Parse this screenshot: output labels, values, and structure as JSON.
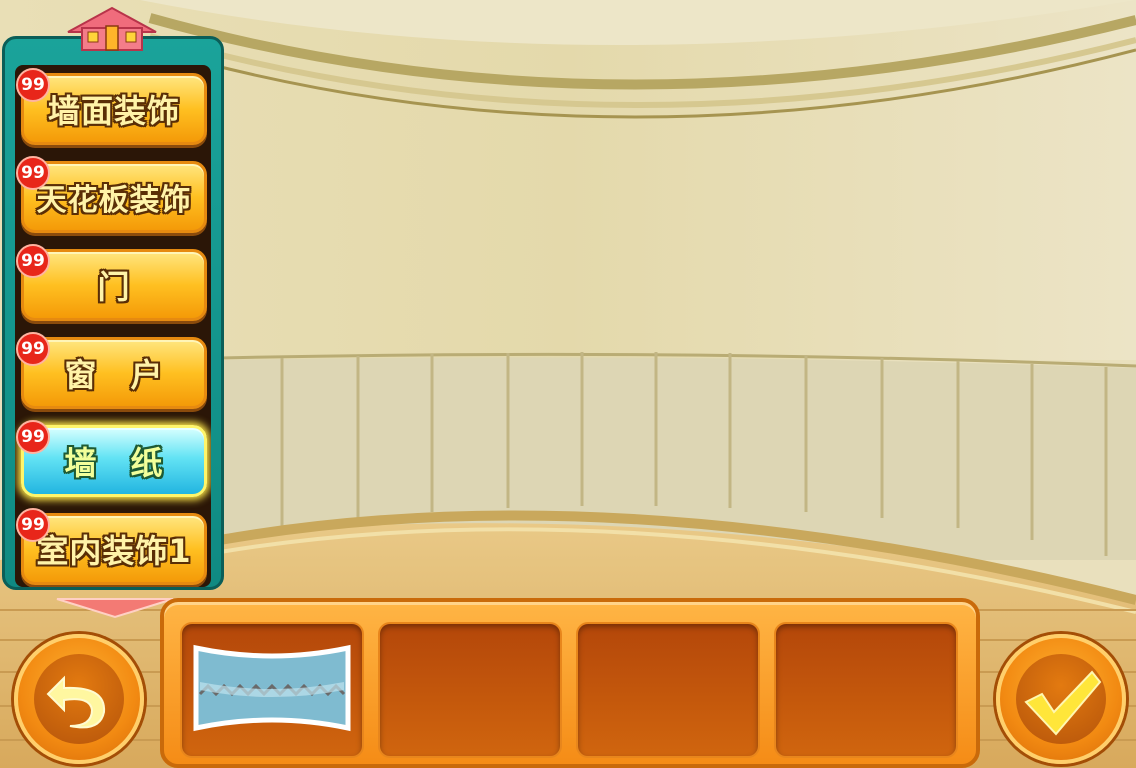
{
  "categories": [
    {
      "label": "墙面装饰",
      "badge": "99",
      "active": false
    },
    {
      "label": "天花板装饰",
      "badge": "99",
      "active": false
    },
    {
      "label": "门",
      "badge": "99",
      "active": false
    },
    {
      "label": "窗　户",
      "badge": "99",
      "active": false
    },
    {
      "label": "墙　纸",
      "badge": "99",
      "active": true
    },
    {
      "label": "室内装饰1",
      "badge": "99",
      "active": false
    }
  ],
  "panel_icons": {
    "top": "house-icon",
    "bottom": "scroll-down-arrow-icon"
  },
  "item_tray": {
    "slots": [
      {
        "item": "wallpaper-swatch-icon",
        "filled": true
      },
      {
        "item": "",
        "filled": false
      },
      {
        "item": "",
        "filled": false
      },
      {
        "item": "",
        "filled": false
      }
    ]
  },
  "buttons": {
    "back_icon": "undo-arrow-icon",
    "confirm_icon": "checkmark-icon"
  },
  "colors": {
    "active_category": "#63e3f4",
    "category_button": "#ffc021",
    "tray": "#f58c16",
    "badge": "#e8261a",
    "panel": "#1aa39a"
  }
}
